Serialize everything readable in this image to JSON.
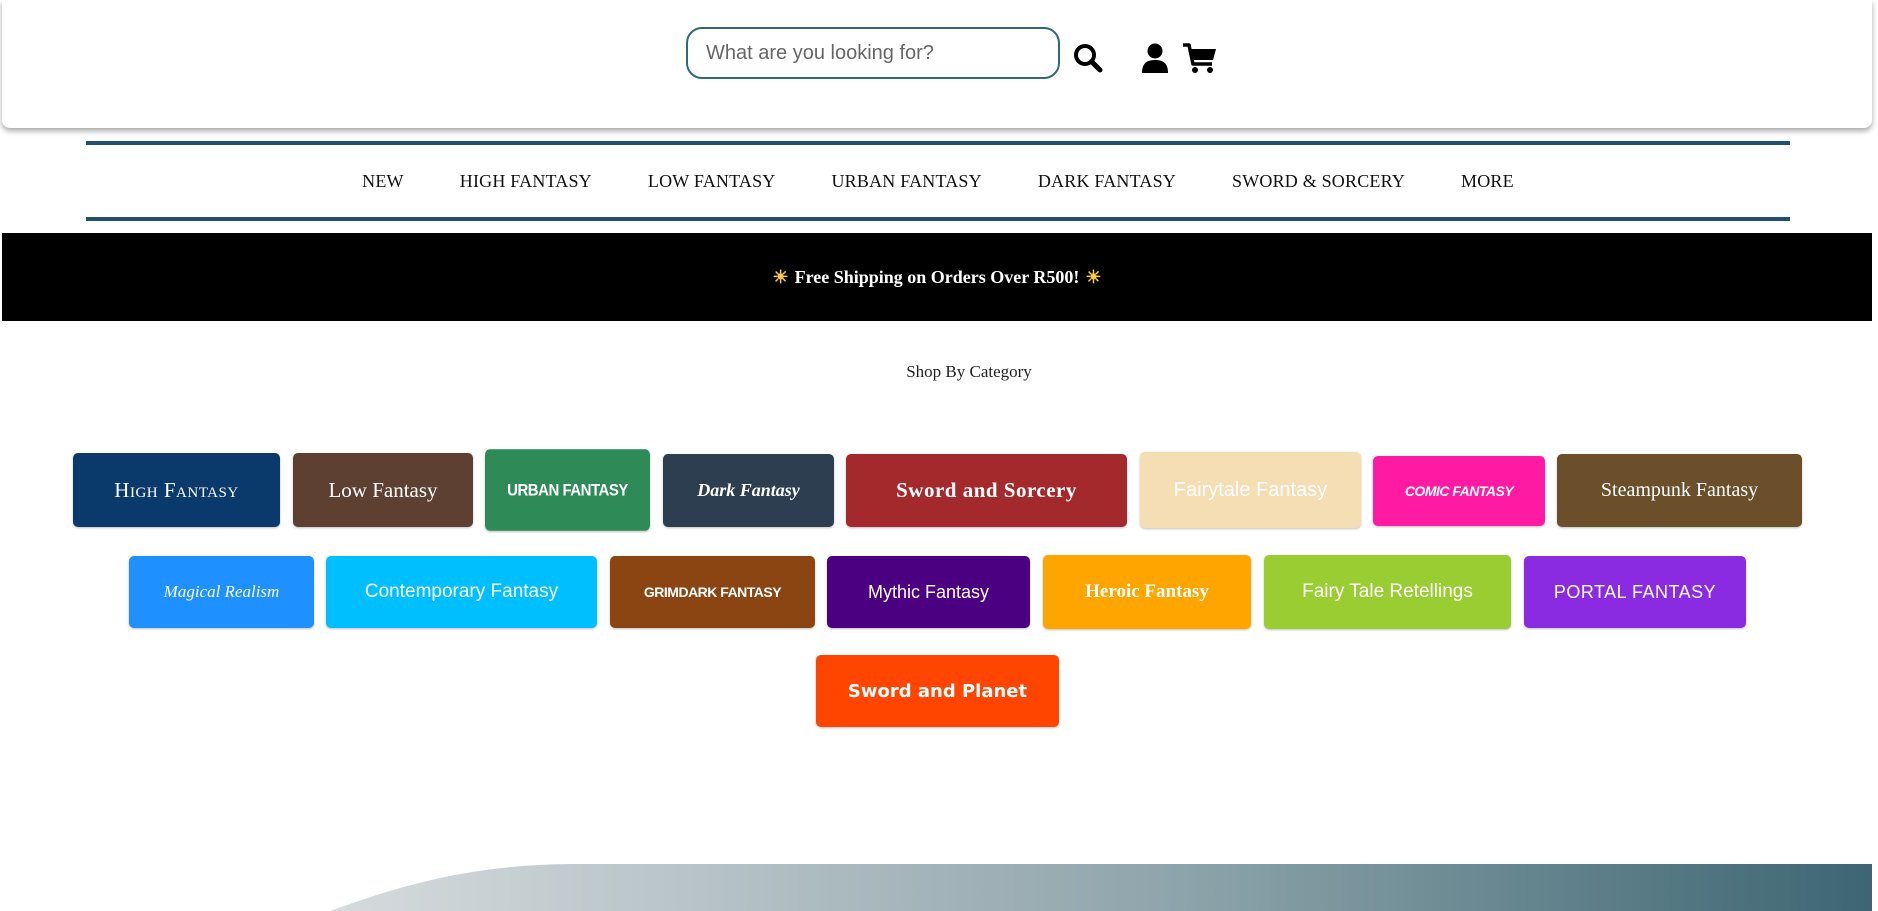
{
  "header": {
    "search_placeholder": "What are you looking for?",
    "icons": [
      "search-icon",
      "user-icon",
      "cart-icon"
    ]
  },
  "nav": {
    "items": [
      "NEW",
      "HIGH FANTASY",
      "LOW FANTASY",
      "URBAN FANTASY",
      "DARK FANTASY",
      "SWORD & SORCERY",
      "MORE"
    ]
  },
  "promo": {
    "text": "Free Shipping on Orders Over R500!",
    "icon": "sun-icon"
  },
  "categories": {
    "title": "Shop By Category",
    "items": [
      {
        "label": "High Fantasy",
        "color": "#0a3a6b"
      },
      {
        "label": "Low Fantasy",
        "color": "#5e4033"
      },
      {
        "label": "URBAN FANTASY",
        "color": "#2e8b57"
      },
      {
        "label": "Dark Fantasy",
        "color": "#2c3e50"
      },
      {
        "label": "Sword and Sorcery",
        "color": "#a4292d"
      },
      {
        "label": "Fairytale Fantasy",
        "color": "#f5deb3"
      },
      {
        "label": "COMIC FANTASY",
        "color": "#ff1aa3"
      },
      {
        "label": "Steampunk Fantasy",
        "color": "#6b4f2a"
      },
      {
        "label": "Magical Realism",
        "color": "#1e90ff"
      },
      {
        "label": "Contemporary Fantasy",
        "color": "#00bfff"
      },
      {
        "label": "GRIMDARK FANTASY",
        "color": "#8b4513"
      },
      {
        "label": "Mythic Fantasy",
        "color": "#4b0082"
      },
      {
        "label": "Heroic Fantasy",
        "color": "#ffa500"
      },
      {
        "label": "Fairy Tale Retellings",
        "color": "#9acd32"
      },
      {
        "label": "PORTAL FANTASY",
        "color": "#8a2be2"
      },
      {
        "label": "Sword and Planet",
        "color": "#ff4500"
      }
    ]
  }
}
